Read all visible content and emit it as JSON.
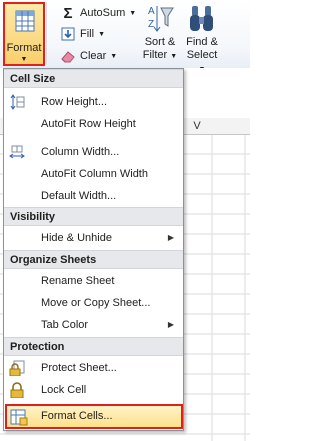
{
  "ribbon": {
    "format_label": "Format",
    "autosum_label": "AutoSum",
    "fill_label": "Fill",
    "clear_label": "Clear",
    "sort_filter_line1": "Sort &",
    "sort_filter_line2": "Filter",
    "find_select_line1": "Find &",
    "find_select_line2": "Select"
  },
  "sheet": {
    "column_v": "V"
  },
  "menu": {
    "sections": {
      "cell_size": "Cell Size",
      "visibility": "Visibility",
      "organize_sheets": "Organize Sheets",
      "protection": "Protection"
    },
    "items": {
      "row_height": "Row Height...",
      "autofit_row_height": "AutoFit Row Height",
      "column_width": "Column Width...",
      "autofit_column_width": "AutoFit Column Width",
      "default_width": "Default Width...",
      "hide_unhide": "Hide & Unhide",
      "rename_sheet": "Rename Sheet",
      "move_copy_sheet": "Move or Copy Sheet...",
      "tab_color": "Tab Color",
      "protect_sheet": "Protect Sheet...",
      "lock_cell": "Lock Cell",
      "format_cells": "Format Cells..."
    }
  },
  "colors": {
    "highlight_border": "#e0201c",
    "highlight_fill": "#fde08b",
    "section_bg": "#e6e8eb"
  },
  "icons": [
    "format-cells-grid-icon",
    "sigma-icon",
    "fill-down-icon",
    "eraser-icon",
    "sort-filter-icon",
    "binoculars-icon",
    "row-height-icon",
    "column-width-icon",
    "protect-sheet-icon",
    "lock-icon",
    "format-cells-icon"
  ]
}
